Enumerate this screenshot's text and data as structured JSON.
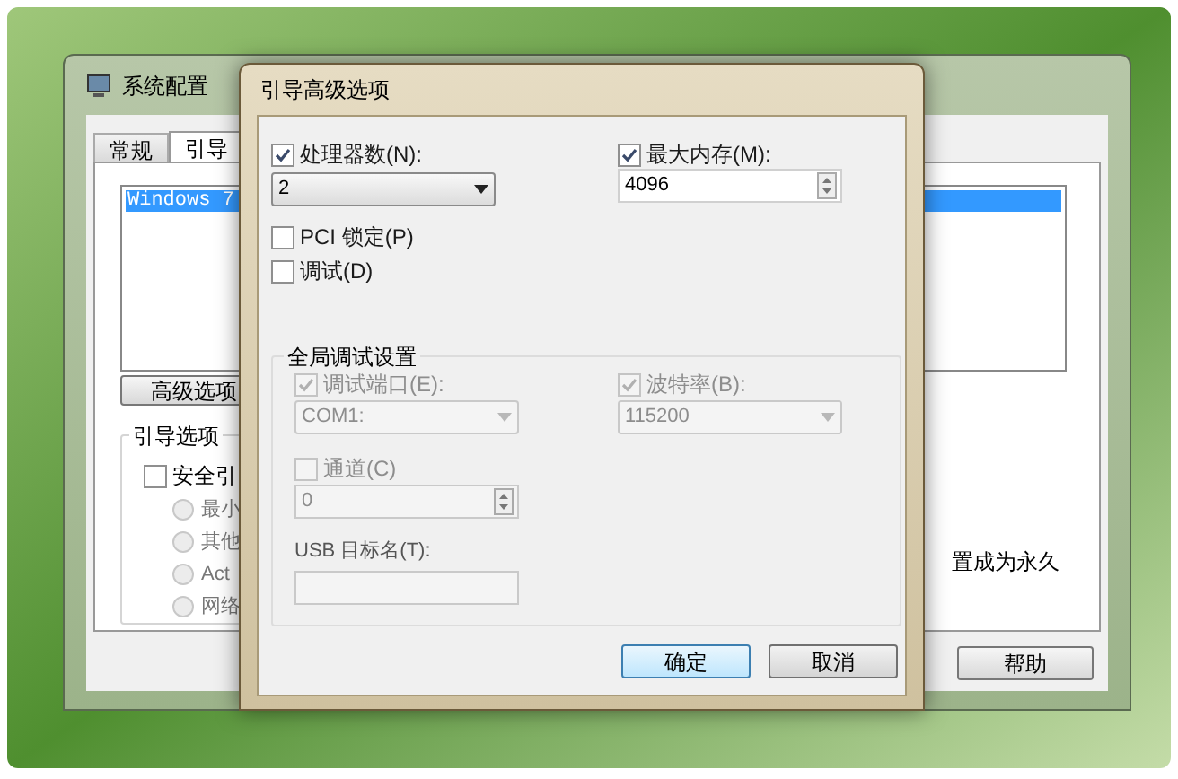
{
  "background_window": {
    "title": "系统配置",
    "tabs": [
      {
        "label": "常规",
        "selected": false
      },
      {
        "label": "引导",
        "selected": true
      }
    ],
    "boot_list": [
      {
        "label": "Windows 7",
        "selected": true
      }
    ],
    "advanced_button": "高级选项",
    "boot_options": {
      "title": "引导选项",
      "safe_boot": {
        "label": "安全引",
        "checked": false
      },
      "radios": [
        {
          "label": "最小",
          "selected": false
        },
        {
          "label": "其他",
          "selected": false
        },
        {
          "label": "Act",
          "selected": false
        },
        {
          "label": "网络",
          "selected": false
        }
      ]
    },
    "permanent_text": "置成为永久",
    "help_button": "帮助"
  },
  "dialog": {
    "title": "引导高级选项",
    "processors": {
      "label": "处理器数(N):",
      "checked": true,
      "value": "2"
    },
    "max_memory": {
      "label": "最大内存(M):",
      "checked": true,
      "value": "4096"
    },
    "pci_lock": {
      "label": "PCI 锁定(P)",
      "checked": false
    },
    "debug": {
      "label": "调试(D)",
      "checked": false
    },
    "debug_settings": {
      "title": "全局调试设置",
      "debug_port": {
        "label": "调试端口(E):",
        "checked": true,
        "disabled": true,
        "value": "COM1:"
      },
      "baud_rate": {
        "label": "波特率(B):",
        "checked": true,
        "disabled": true,
        "value": "115200"
      },
      "channel": {
        "label": "通道(C)",
        "checked": false,
        "disabled": true,
        "value": "0"
      },
      "usb_target": {
        "label": "USB 目标名(T):",
        "disabled": true
      }
    },
    "ok_button": "确定",
    "cancel_button": "取消"
  }
}
